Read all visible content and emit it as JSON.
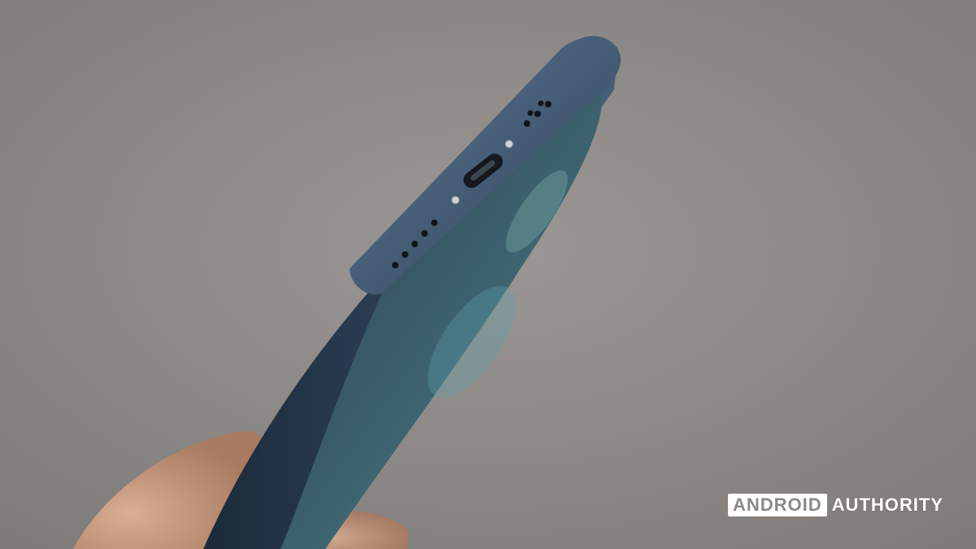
{
  "image": {
    "subject": "phone-bottom-edge-usb-c-port",
    "background_color": "#8f8c8a",
    "frame_color": "#2c3d52",
    "hand_color": "#c99c82"
  },
  "watermark": {
    "brand_box": "ANDROID",
    "brand_text": "AUTHORITY"
  }
}
